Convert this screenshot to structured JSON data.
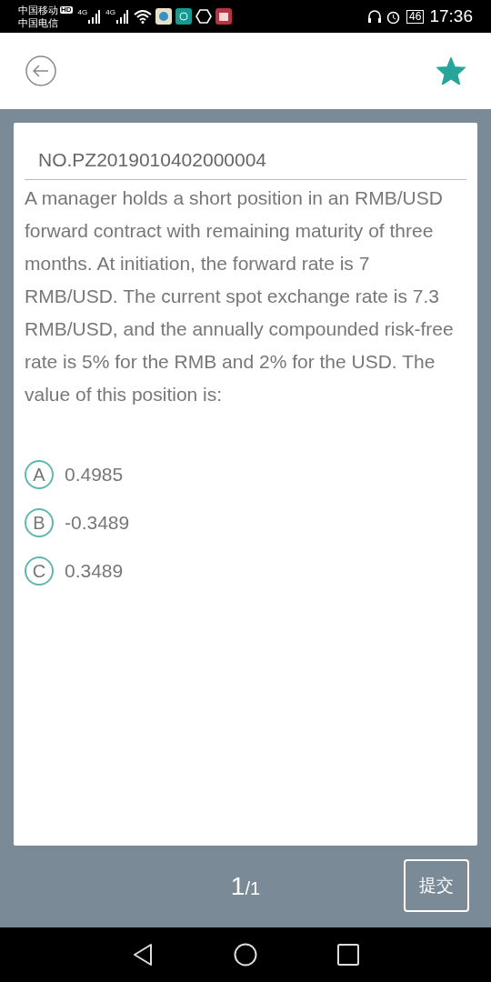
{
  "status_bar": {
    "carriers": [
      {
        "name": "中国移动",
        "badge": "HD"
      },
      {
        "name": "中国电信"
      }
    ],
    "networks": [
      "4G",
      "4G"
    ],
    "battery": "46",
    "time": "17:36"
  },
  "header": {
    "favorited": true
  },
  "question": {
    "id": "NO.PZ2019010402000004",
    "text": "A manager holds a short position in an RMB/USD forward contract with remaining maturity of three months. At initiation, the forward rate is 7 RMB/USD. The current spot exchange rate is 7.3 RMB/USD, and the annually compounded risk-free rate is 5% for the RMB and 2% for the USD. The value of this position is:",
    "options": [
      {
        "letter": "A",
        "text": "0.4985",
        "selected": false
      },
      {
        "letter": "B",
        "text": "-0.3489",
        "selected": false
      },
      {
        "letter": "C",
        "text": "0.3489",
        "selected": false
      }
    ]
  },
  "footer": {
    "current": "1",
    "total": "/1",
    "submit": "提交"
  }
}
